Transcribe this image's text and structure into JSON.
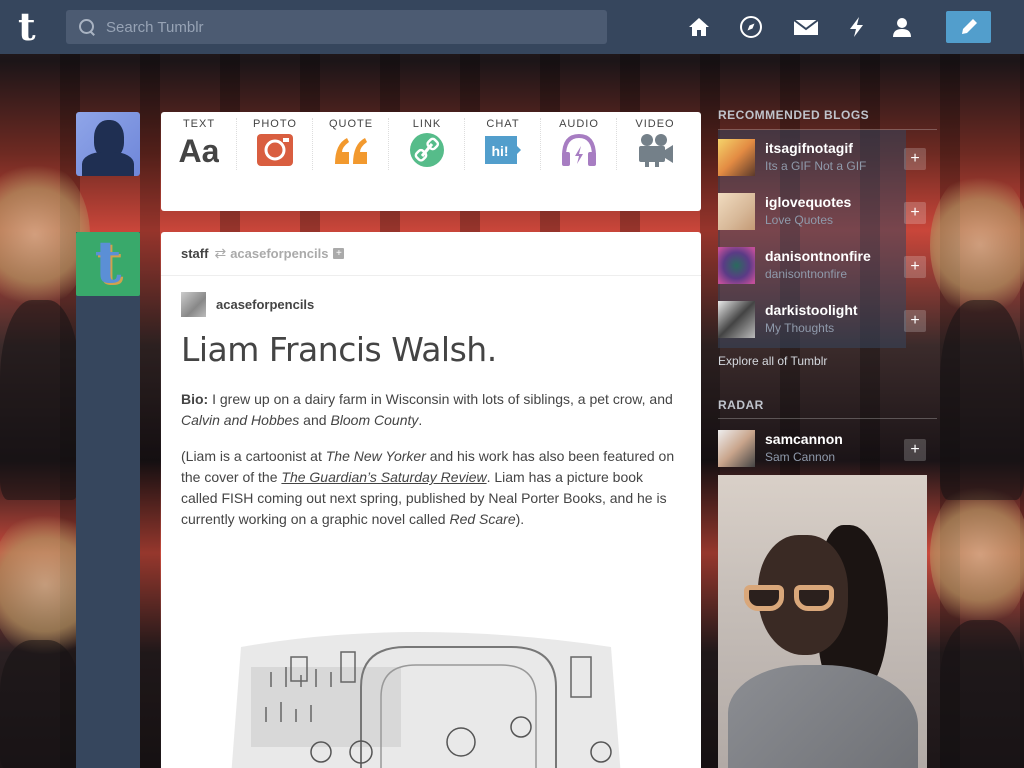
{
  "nav": {
    "logo": "t",
    "search_placeholder": "Search Tumblr",
    "icons": [
      "home-icon",
      "explore-icon",
      "messages-icon",
      "activity-icon",
      "account-icon",
      "compose-icon"
    ]
  },
  "post_types": [
    {
      "label": "TEXT",
      "icon": "text-icon",
      "color": "#444444"
    },
    {
      "label": "PHOTO",
      "icon": "photo-icon",
      "color": "#d95e40"
    },
    {
      "label": "QUOTE",
      "icon": "quote-icon",
      "color": "#f2992e"
    },
    {
      "label": "LINK",
      "icon": "link-icon",
      "color": "#56bc8a"
    },
    {
      "label": "CHAT",
      "icon": "chat-icon",
      "color": "#529ecc"
    },
    {
      "label": "AUDIO",
      "icon": "audio-icon",
      "color": "#a77dc2"
    },
    {
      "label": "VIDEO",
      "icon": "video-icon",
      "color": "#748089"
    }
  ],
  "post": {
    "reblogger": "staff",
    "source": "acaseforpencils",
    "author": "acaseforpencils",
    "title": "Liam Francis Walsh.",
    "bio_label": "Bio:",
    "bio_text_1": " I grew up on a dairy farm in Wisconsin with lots of siblings, a pet crow, and ",
    "bio_em_1": "Calvin and Hobbes",
    "bio_text_2": " and ",
    "bio_em_2": "Bloom County",
    "bio_text_3": ".",
    "p2_text_1": "(Liam is a cartoonist at ",
    "p2_em_1": "The New Yorker",
    "p2_text_2": " and his work has also been featured on the cover of the ",
    "p2_link": "The Guardian’s Saturday Review",
    "p2_text_3": ". Liam has a picture book called FISH coming out next spring, published by Neal Porter Books, and he is currently working on a graphic novel called ",
    "p2_em_2": "Red Scare",
    "p2_text_4": ")."
  },
  "sidebar": {
    "recommended_title": "RECOMMENDED BLOGS",
    "recommended": [
      {
        "name": "itsagifnotagif",
        "subtitle": "Its a GIF Not a GIF"
      },
      {
        "name": "iglovequotes",
        "subtitle": "Love Quotes"
      },
      {
        "name": "danisontnonfire",
        "subtitle": "danisontnonfire"
      },
      {
        "name": "darkistoolight",
        "subtitle": "My Thoughts"
      }
    ],
    "explore_link": "Explore all of Tumblr",
    "radar_title": "RADAR",
    "radar": {
      "name": "samcannon",
      "subtitle": "Sam Cannon"
    },
    "add_label": "+"
  }
}
